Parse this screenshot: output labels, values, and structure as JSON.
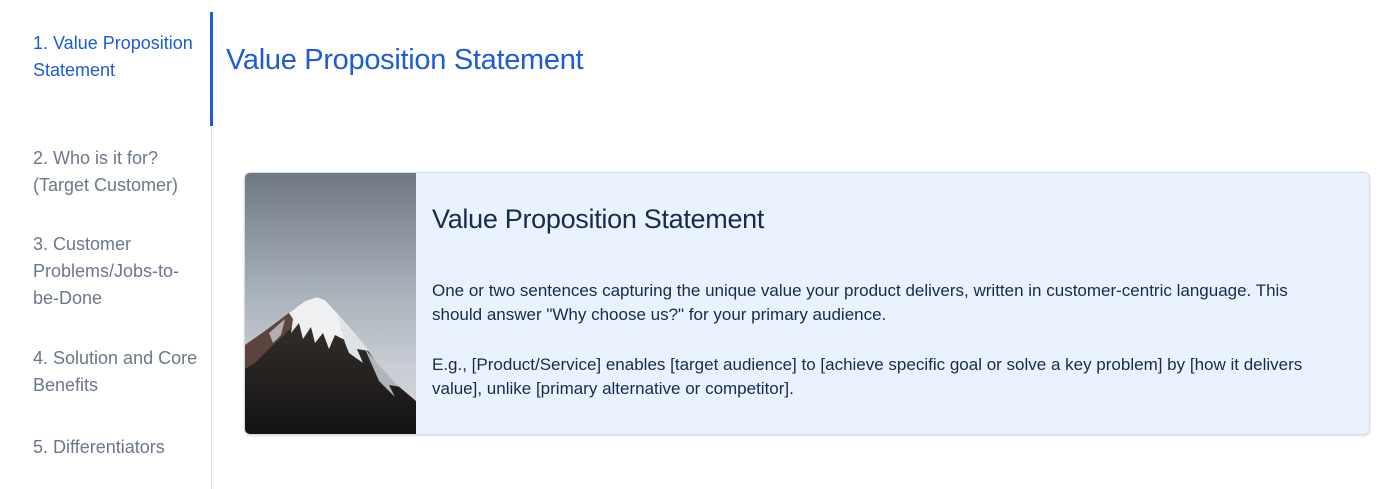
{
  "toc": {
    "items": [
      {
        "label": "1. Value Proposition Statement",
        "active": true
      },
      {
        "label": "2. Who is it for? (Target Customer)",
        "active": false
      },
      {
        "label": "3. Customer Problems/Jobs-to-be-Done",
        "active": false
      },
      {
        "label": "4. Solution and Core Benefits",
        "active": false
      },
      {
        "label": "5. Differentiators",
        "active": false
      }
    ]
  },
  "main": {
    "title": "Value Proposition Statement",
    "card": {
      "image_icon": "mountain-image",
      "title": "Value Proposition Statement",
      "paragraph_1": "One or two sentences capturing the unique value your product delivers, written in customer-centric language. This should answer \"Why choose us?\" for your primary audience.",
      "paragraph_2": "E.g., [Product/Service] enables [target audience] to [achieve specific goal or solve a key problem] by [how it delivers value], unlike [primary alternative or competitor]."
    }
  },
  "colors": {
    "accent": "#1d5bd7",
    "toc_inactive": "#6b778c",
    "card_background": "#e9f2fe",
    "text": "#172b4d"
  }
}
